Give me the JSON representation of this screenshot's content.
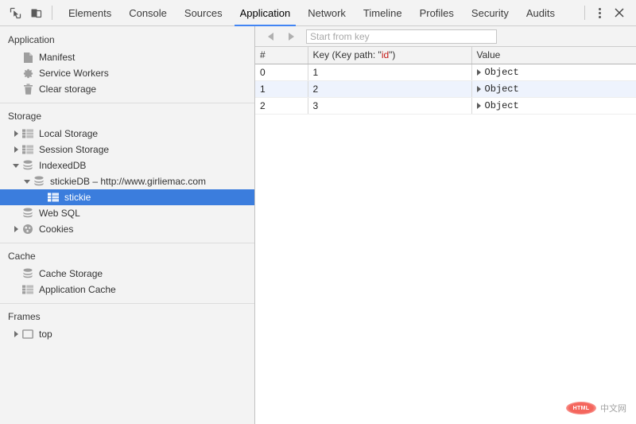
{
  "toolbar": {
    "inspect_icon": "inspect-element-icon",
    "device_icon": "device-toolbar-icon",
    "tabs": [
      {
        "label": "Elements",
        "active": false
      },
      {
        "label": "Console",
        "active": false
      },
      {
        "label": "Sources",
        "active": false
      },
      {
        "label": "Application",
        "active": true
      },
      {
        "label": "Network",
        "active": false
      },
      {
        "label": "Timeline",
        "active": false
      },
      {
        "label": "Profiles",
        "active": false
      },
      {
        "label": "Security",
        "active": false
      },
      {
        "label": "Audits",
        "active": false
      }
    ],
    "more_icon": "kebab-menu-icon",
    "close_icon": "close-icon",
    "accent_color": "#4285f4"
  },
  "sidebar": {
    "sections": [
      {
        "title": "Application",
        "items": [
          {
            "label": "Manifest",
            "icon": "document-icon",
            "indent": 1,
            "twisty": "none",
            "selected": false
          },
          {
            "label": "Service Workers",
            "icon": "gear-icon",
            "indent": 1,
            "twisty": "none",
            "selected": false
          },
          {
            "label": "Clear storage",
            "icon": "trash-icon",
            "indent": 1,
            "twisty": "none",
            "selected": false
          }
        ]
      },
      {
        "title": "Storage",
        "items": [
          {
            "label": "Local Storage",
            "icon": "table-icon",
            "indent": 1,
            "twisty": "right",
            "selected": false
          },
          {
            "label": "Session Storage",
            "icon": "table-icon",
            "indent": 1,
            "twisty": "right",
            "selected": false
          },
          {
            "label": "IndexedDB",
            "icon": "database-icon",
            "indent": 1,
            "twisty": "down",
            "selected": false
          },
          {
            "label": "stickieDB – http://www.girliemac.com",
            "icon": "database-icon",
            "indent": 2,
            "twisty": "down",
            "selected": false
          },
          {
            "label": "stickie",
            "icon": "table-icon",
            "indent": 3,
            "twisty": "none",
            "selected": true
          },
          {
            "label": "Web SQL",
            "icon": "database-icon",
            "indent": 1,
            "twisty": "none",
            "selected": false
          },
          {
            "label": "Cookies",
            "icon": "cookie-icon",
            "indent": 1,
            "twisty": "right",
            "selected": false
          }
        ]
      },
      {
        "title": "Cache",
        "items": [
          {
            "label": "Cache Storage",
            "icon": "database-icon",
            "indent": 1,
            "twisty": "none",
            "selected": false
          },
          {
            "label": "Application Cache",
            "icon": "table-icon",
            "indent": 1,
            "twisty": "none",
            "selected": false
          }
        ]
      },
      {
        "title": "Frames",
        "items": [
          {
            "label": "top",
            "icon": "frame-icon",
            "indent": 1,
            "twisty": "right",
            "selected": false
          }
        ]
      }
    ],
    "selected_color": "#3b7ddd"
  },
  "panel": {
    "prev_icon": "arrow-left-icon",
    "next_icon": "arrow-right-icon",
    "start_from_key": {
      "value": "",
      "placeholder": "Start from key"
    },
    "table": {
      "columns": [
        {
          "label": "#"
        },
        {
          "label_prefix": "Key (Key path: \"",
          "label_keypath": "id",
          "label_suffix": "\")"
        },
        {
          "label": "Value"
        }
      ],
      "keypath_color": "#c41a16",
      "rows": [
        {
          "index": "0",
          "key": "1",
          "value": "Object",
          "alt": false
        },
        {
          "index": "1",
          "key": "2",
          "value": "Object",
          "alt": true
        },
        {
          "index": "2",
          "key": "3",
          "value": "Object",
          "alt": false
        }
      ]
    }
  },
  "watermark": {
    "badge": "HTML",
    "text": "中文网"
  }
}
